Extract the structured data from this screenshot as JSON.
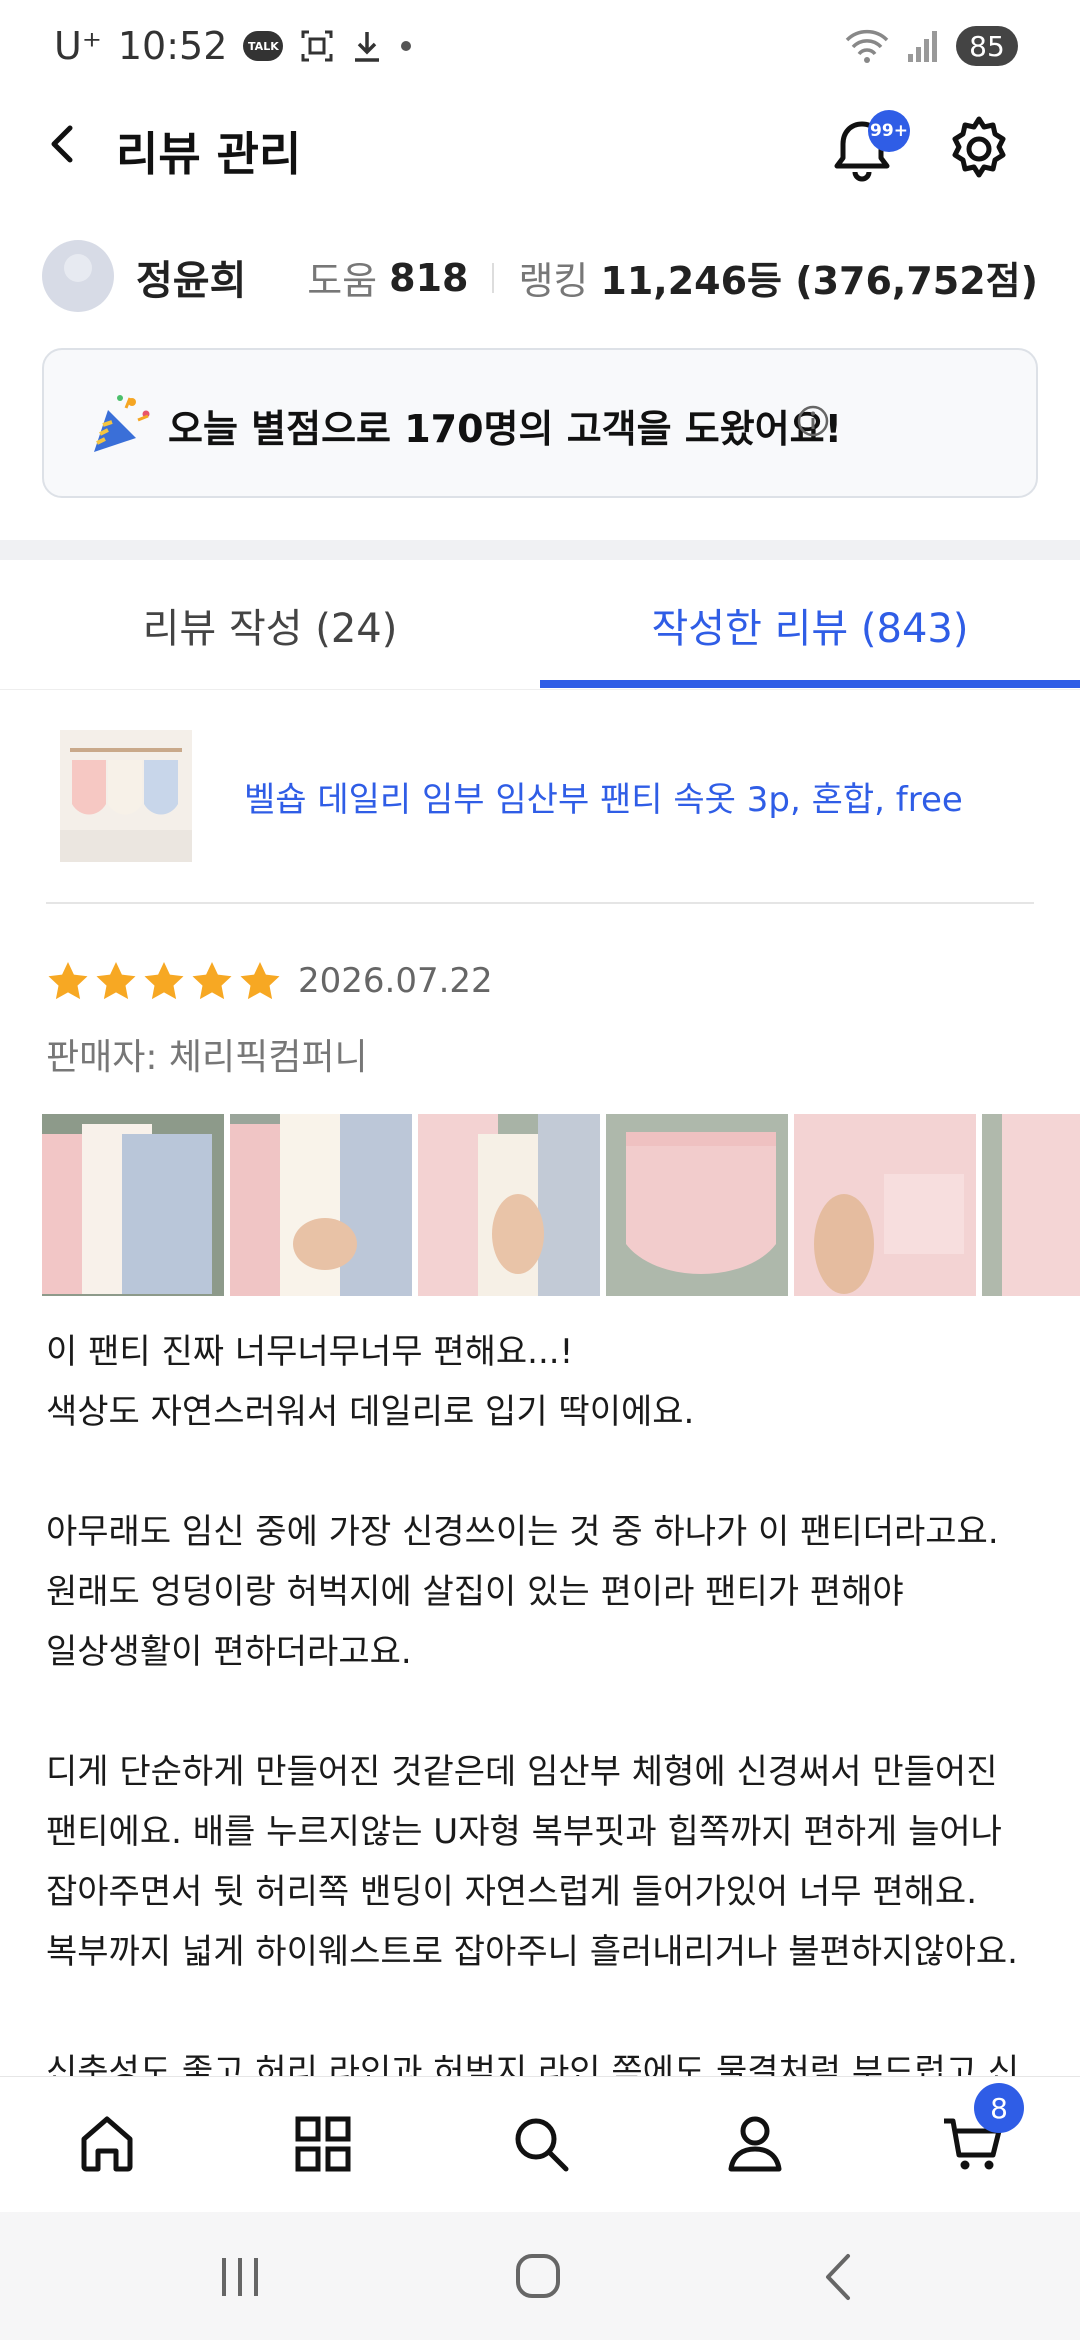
{
  "status_bar": {
    "carrier": "U⁺",
    "time": "10:52",
    "talk_badge": "TALK",
    "battery": "85",
    "icons": [
      "talk-icon",
      "screenshot-icon",
      "download-icon",
      "dot-icon",
      "wifi-icon",
      "signal-icon"
    ]
  },
  "header": {
    "title": "리뷰 관리",
    "notification_badge": "99+"
  },
  "profile": {
    "name": "정윤희",
    "help_label": "도움",
    "help_value": "818",
    "ranking_label": "랭킹",
    "ranking_value": "11,246등 (376,752점)"
  },
  "notice": {
    "text": "오늘 별점으로 170명의 고객을 도왔어요!"
  },
  "tabs": [
    {
      "label": "리뷰 작성 (24)",
      "active": false
    },
    {
      "label": "작성한 리뷰 (843)",
      "active": true
    }
  ],
  "product": {
    "name": "벨숍 데일리 임부 임산부 팬티 속옷 3p, 혼합, free"
  },
  "review": {
    "rating": 5,
    "date": "2026.07.22",
    "seller": "판매자: 체리픽컴퍼니",
    "paragraphs": [
      [
        "이 팬티 진짜 너무너무너무 편해요...!",
        "색상도 자연스러워서 데일리로 입기 딱이에요."
      ],
      [
        "아무래도 임신 중에 가장 신경쓰이는 것 중 하나가 이 팬티더라고요.",
        "원래도 엉덩이랑 허벅지에 살집이 있는 편이라 팬티가 편해야",
        "일상생활이 편하더라고요."
      ],
      [
        "디게 단순하게 만들어진 것같은데 임산부 체형에 신경써서 만들어진",
        "팬티에요. 배를 누르지않는 U자형 복부핏과 힙쪽까지 편하게 늘어나",
        "잡아주면서 뒷 허리쪽 밴딩이 자연스럽게 들어가있어 너무 편해요.",
        "복부까지 넓게 하이웨스트로 잡아주니 흘러내리거나 불편하지않아요."
      ],
      [
        "신축성도 좋고 허리 라인과 허벅지 라인 쪽에도 물결처럼 부드럽고 신축성"
      ]
    ]
  },
  "bottom_nav": {
    "items": [
      "home-icon",
      "category-icon",
      "search-icon",
      "my-page-icon",
      "cart-icon"
    ],
    "cart_badge": "8"
  },
  "colors": {
    "accent": "#2f5de6",
    "star": "#f7a823"
  }
}
